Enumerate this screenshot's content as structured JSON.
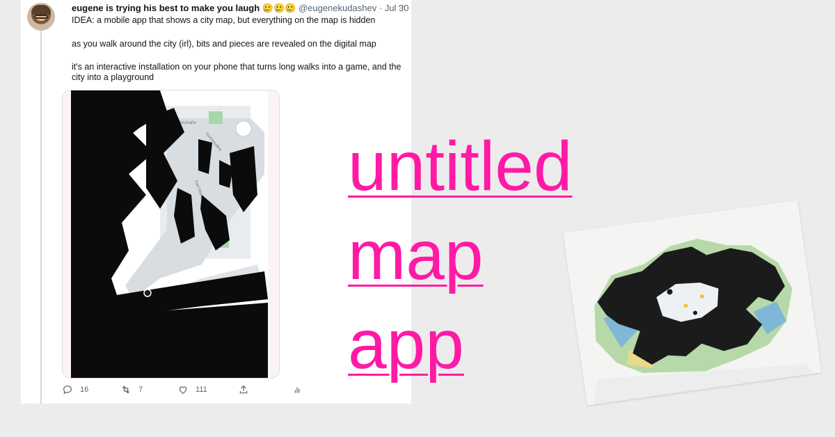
{
  "tweet": {
    "author_name": "eugene is trying his best to make you laugh",
    "author_emojis": "🥲🥲🥲",
    "handle": "@eugenekudashev",
    "date": "Jul 30",
    "more_label": "···",
    "paragraphs": [
      "IDEA: a mobile app that shows a city map, but everything on the map is hidden",
      "as you walk around the city (irl), bits and pieces are revealed on the digital map",
      "it's an interactive installation on your phone that turns long walks into a game, and the city into a playground"
    ],
    "media_map_labels": [
      "Erkstraße",
      "Sonnenallee",
      "Karl-Marx-Straße",
      "N"
    ],
    "actions": {
      "replies": "16",
      "retweets": "7",
      "likes": "111"
    }
  },
  "title": {
    "line1": "untitled",
    "line2": "map",
    "line3": "app"
  },
  "colors": {
    "accent": "#ff1aa6",
    "tweet_text": "#0f1419",
    "muted": "#536471",
    "background": "#ececec"
  }
}
